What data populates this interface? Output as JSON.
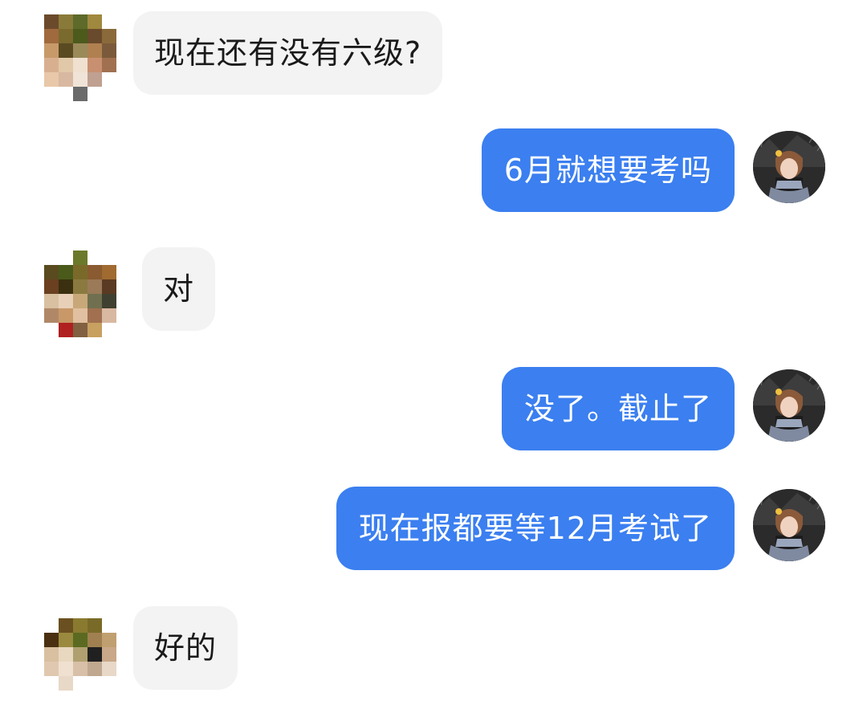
{
  "messages": [
    {
      "id": "m1",
      "direction": "incoming",
      "text": "现在还有没有六级?"
    },
    {
      "id": "m2",
      "direction": "outgoing",
      "text": "6月就想要考吗"
    },
    {
      "id": "m3",
      "direction": "incoming",
      "text": "对"
    },
    {
      "id": "m4",
      "direction": "outgoing",
      "text": "没了。截止了"
    },
    {
      "id": "m5",
      "direction": "outgoing",
      "text": "现在报都要等12月考试了"
    },
    {
      "id": "m6",
      "direction": "incoming",
      "text": "好的"
    }
  ],
  "colors": {
    "incoming_bubble": "#f3f3f3",
    "outgoing_bubble": "#3b7ff0",
    "outgoing_text": "#ffffff",
    "incoming_text": "#1a1a1a"
  },
  "avatars": {
    "contact": "pixelated-avatar",
    "self": "photo-avatar-girl"
  }
}
